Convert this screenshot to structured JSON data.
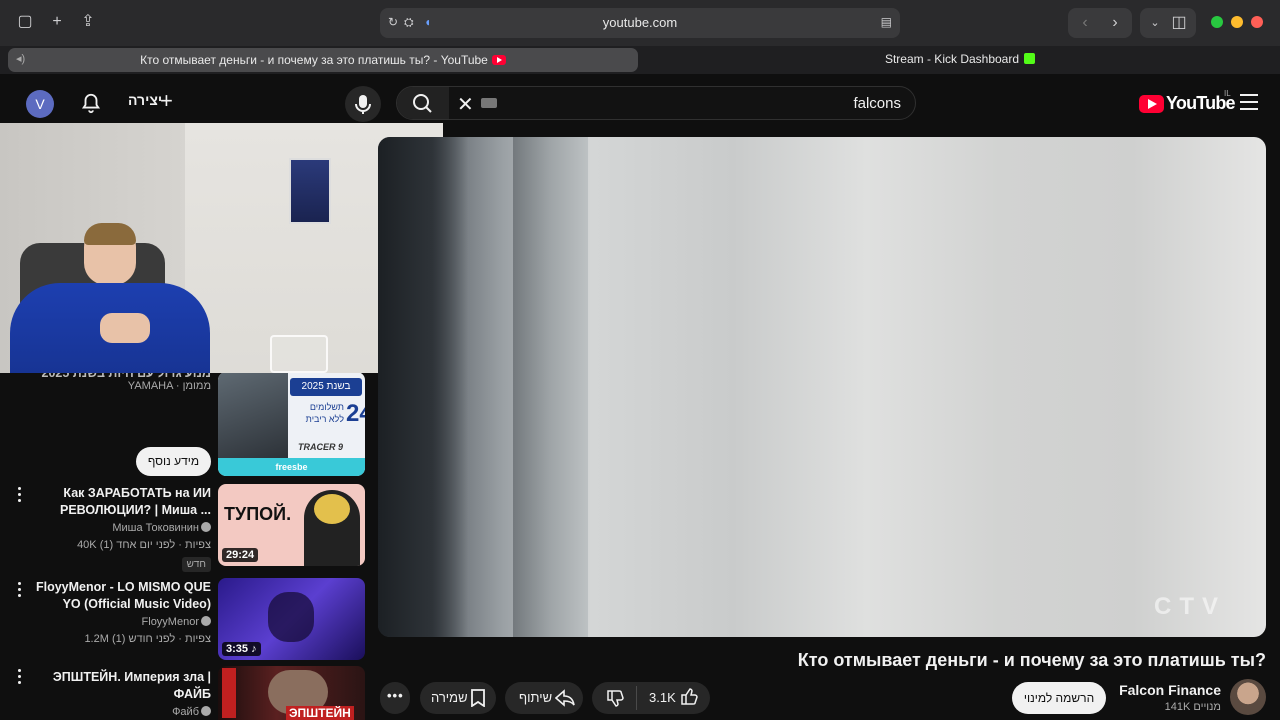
{
  "browser": {
    "url": "youtube.com",
    "tabs": [
      {
        "label": "Кто отмывает деньги - и почему за это платишь ты? - YouTube",
        "active": true
      },
      {
        "label": "Stream - Kick Dashboard",
        "active": false
      }
    ]
  },
  "header": {
    "avatar_letter": "V",
    "create_label": "יצירה",
    "search_value": "falcons",
    "logo_text": "YouTube",
    "region": "IL"
  },
  "video": {
    "title": "Кто отмывает деньги - и почему за это платишь ты?",
    "watermark": "CTV",
    "channel": "Falcon Finance",
    "subscribers": "141K מנויים",
    "subscribe_label": "הרשמה למינוי",
    "likes": "3.1K",
    "share_label": "שיתוף",
    "save_label": "שמירה"
  },
  "sidebar": {
    "ad": {
      "title_partial": "מנוע גדול עם חיות בשנת 2025",
      "channel": "YAMAHA · ממומן",
      "more_info": "מידע נוסף",
      "thumb_line1": "בשנת 2025",
      "thumb_number": "24",
      "thumb_line2": "תשלומים",
      "thumb_line3": "ללא ריבית",
      "thumb_model": "TRACER 9",
      "thumb_brand": "freesbe"
    },
    "items": [
      {
        "title": "Как ЗАРАБОТАТЬ на ИИ РЕВОЛЮЦИИ? | Миша ...",
        "channel": "Миша Токовинин",
        "meta": "40K צפיות · לפני יום אחד (1)",
        "badge": "חדש",
        "duration": "29:24",
        "thumb_text": "ТУПОЙ."
      },
      {
        "title": "FloyyMenor - LO MISMO QUE YO (Official Music Video)",
        "channel": "FloyyMenor",
        "meta": "1.2M צפיות · לפני חודש (1)",
        "duration": "3:35 ♪"
      },
      {
        "title": "ЭПШТЕЙН. Империя зла | ФАЙБ",
        "channel": "Файб",
        "thumb_text": "ЭПШТЕЙН"
      }
    ]
  },
  "colors": {
    "bg": "#0f0f0f",
    "yt_red": "#ff0033",
    "kick_green": "#53fc18"
  }
}
